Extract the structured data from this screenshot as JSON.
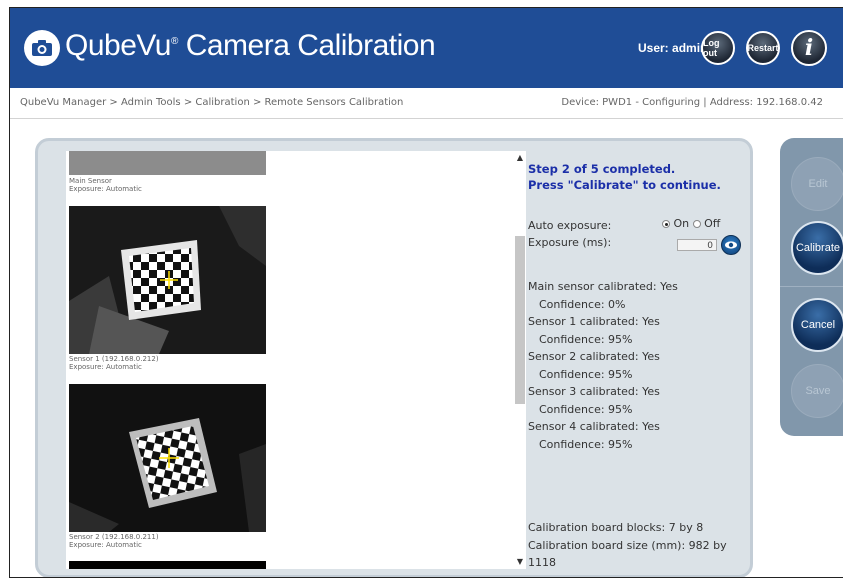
{
  "header": {
    "title": "QubeVu",
    "title_mark": "®",
    "title_rest": " Camera Calibration",
    "user": "User: admin",
    "logout": "Log out",
    "restart": "Restart",
    "info": "i",
    "brand_color": "#1f4d96"
  },
  "breadcrumb": "QubeVu Manager > Admin Tools > Calibration > Remote Sensors Calibration",
  "device": "Device: PWD1 - Configuring | Address: 192.168.0.42",
  "sensors": [
    {
      "name": "Main Sensor",
      "exposure": "Exposure: Automatic"
    },
    {
      "name": "Sensor 1 (192.168.0.212)",
      "exposure": "Exposure: Automatic"
    },
    {
      "name": "Sensor 2 (192.168.0.211)",
      "exposure": "Exposure: Automatic"
    }
  ],
  "status": {
    "line1": "Step 2 of 5 completed.",
    "line2": "Press \"Calibrate\" to continue."
  },
  "controls": {
    "auto_exposure_label": "Auto exposure:",
    "on": "On",
    "off": "Off",
    "selected": "On",
    "exposure_label": "Exposure (ms):",
    "exposure_value": "0"
  },
  "results": [
    {
      "label": "Main sensor calibrated: Yes",
      "confidence": "Confidence: 0%"
    },
    {
      "label": "Sensor 1 calibrated: Yes",
      "confidence": "Confidence: 95%"
    },
    {
      "label": "Sensor 2 calibrated: Yes",
      "confidence": "Confidence: 95%"
    },
    {
      "label": "Sensor 3 calibrated: Yes",
      "confidence": "Confidence: 95%"
    },
    {
      "label": "Sensor 4 calibrated: Yes",
      "confidence": "Confidence: 95%"
    }
  ],
  "board": {
    "blocks": "Calibration board blocks: 7 by 8",
    "size_line1": "Calibration board size (mm): 982 by",
    "size_line2": "1118"
  },
  "actions": {
    "edit": "Edit",
    "calibrate": "Calibrate",
    "cancel": "Cancel",
    "save": "Save"
  }
}
